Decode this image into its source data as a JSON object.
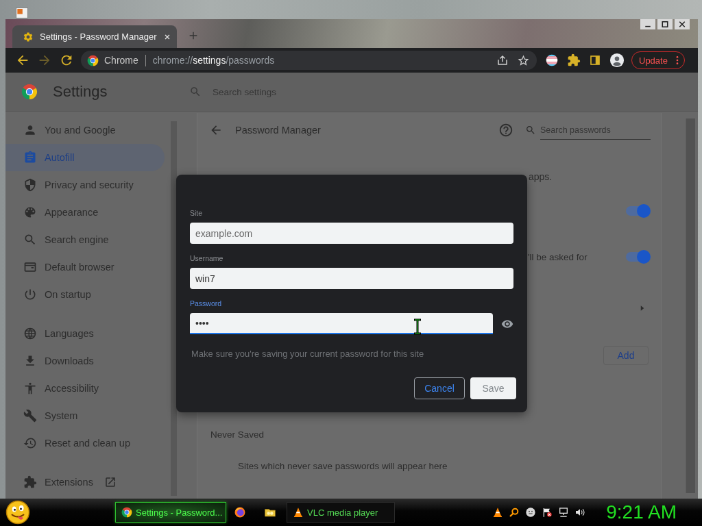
{
  "browser": {
    "tabs": [
      {
        "title": "Settings - Password Manager",
        "selected": true
      }
    ],
    "nav": [
      {
        "kind": "back",
        "disabled": false
      },
      {
        "kind": "forward",
        "disabled": true
      },
      {
        "kind": "reload",
        "disabled": false
      }
    ],
    "omnibox": {
      "chip": "Chrome",
      "url": "chrome://**settings**/passwords"
    },
    "update_button": "Update"
  },
  "settings": {
    "title": "Settings",
    "search_placeholder": "Search settings",
    "sidebar": {
      "groups": [
        [
          {
            "label": "You and Google",
            "selected": false
          },
          {
            "label": "Autofill",
            "selected": true
          },
          {
            "label": "Privacy and security",
            "selected": false
          },
          {
            "label": "Appearance",
            "selected": false
          },
          {
            "label": "Search engine",
            "selected": false
          },
          {
            "label": "Default browser",
            "selected": false
          },
          {
            "label": "On startup",
            "selected": false
          }
        ],
        [
          {
            "label": "Languages",
            "selected": false
          },
          {
            "label": "Downloads",
            "selected": false
          },
          {
            "label": "Accessibility",
            "selected": false
          },
          {
            "label": "System",
            "selected": false
          },
          {
            "label": "Reset and clean up",
            "selected": false
          }
        ],
        [
          {
            "label": "Extensions",
            "selected": false
          }
        ]
      ]
    },
    "page": {
      "title": "Password Manager",
      "search_placeholder": "Search passwords",
      "fragment_1": "apps.",
      "toggles": [
        {
          "on": true
        },
        {
          "on": true,
          "text": "'ll be asked for"
        }
      ],
      "add_button": "Add",
      "never_saved": {
        "heading": "Never Saved",
        "empty_text": "Sites which never save passwords will appear here"
      }
    }
  },
  "dialog": {
    "fields": [
      {
        "kind": "text",
        "label": "Site",
        "placeholder": "example.com",
        "focused": false
      },
      {
        "kind": "text",
        "label": "Username",
        "value": "win7",
        "focused": false
      },
      {
        "kind": "password",
        "label": "Password",
        "value": "••••",
        "focused": true
      }
    ],
    "hint": "Make sure you're saving your current password for this site",
    "buttons": [
      {
        "label": "Cancel",
        "kind": "secondary",
        "disabled": false
      },
      {
        "label": "Save",
        "kind": "primary",
        "disabled": true
      }
    ]
  },
  "taskbar": {
    "tasks": [
      {
        "kind": "window",
        "label": "Settings - Password...",
        "selected": true
      },
      {
        "kind": "pinned",
        "selected": false
      },
      {
        "kind": "pinned",
        "selected": false
      },
      {
        "kind": "window",
        "label": "VLC media player",
        "selected": false
      }
    ],
    "clock": "9:21 AM"
  }
}
